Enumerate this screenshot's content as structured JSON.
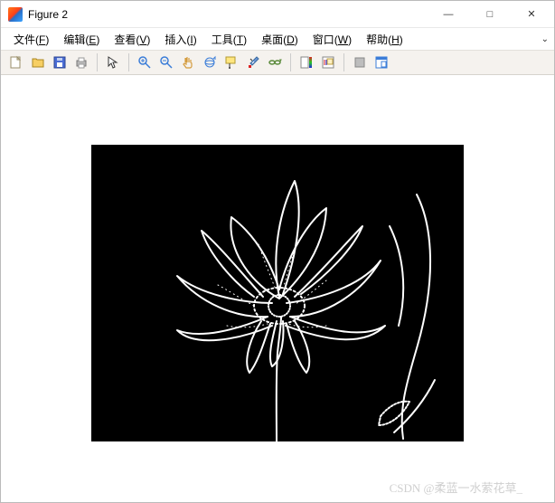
{
  "window": {
    "title": "Figure 2",
    "min": "—",
    "max": "□",
    "close": "✕"
  },
  "menu": {
    "file": "文件(F)",
    "edit": "编辑(E)",
    "view": "查看(V)",
    "insert": "插入(I)",
    "tools": "工具(T)",
    "desktop": "桌面(D)",
    "window": "窗口(W)",
    "help": "帮助(H)",
    "arrow": "⌄"
  },
  "toolbar": {
    "new": "新建",
    "open": "打开",
    "save": "保存",
    "print": "打印",
    "pointer": "指针",
    "zoom_in": "放大",
    "zoom_out": "缩小",
    "pan": "平移",
    "rotate3d": "三维旋转",
    "datacursor": "数据游标",
    "brush": "刷选",
    "link": "链接",
    "colorbar": "颜色栏",
    "legend": "图例",
    "hide": "隐藏",
    "dock": "停靠"
  },
  "watermark": "CSDN @柔蓝一水萦花草_"
}
